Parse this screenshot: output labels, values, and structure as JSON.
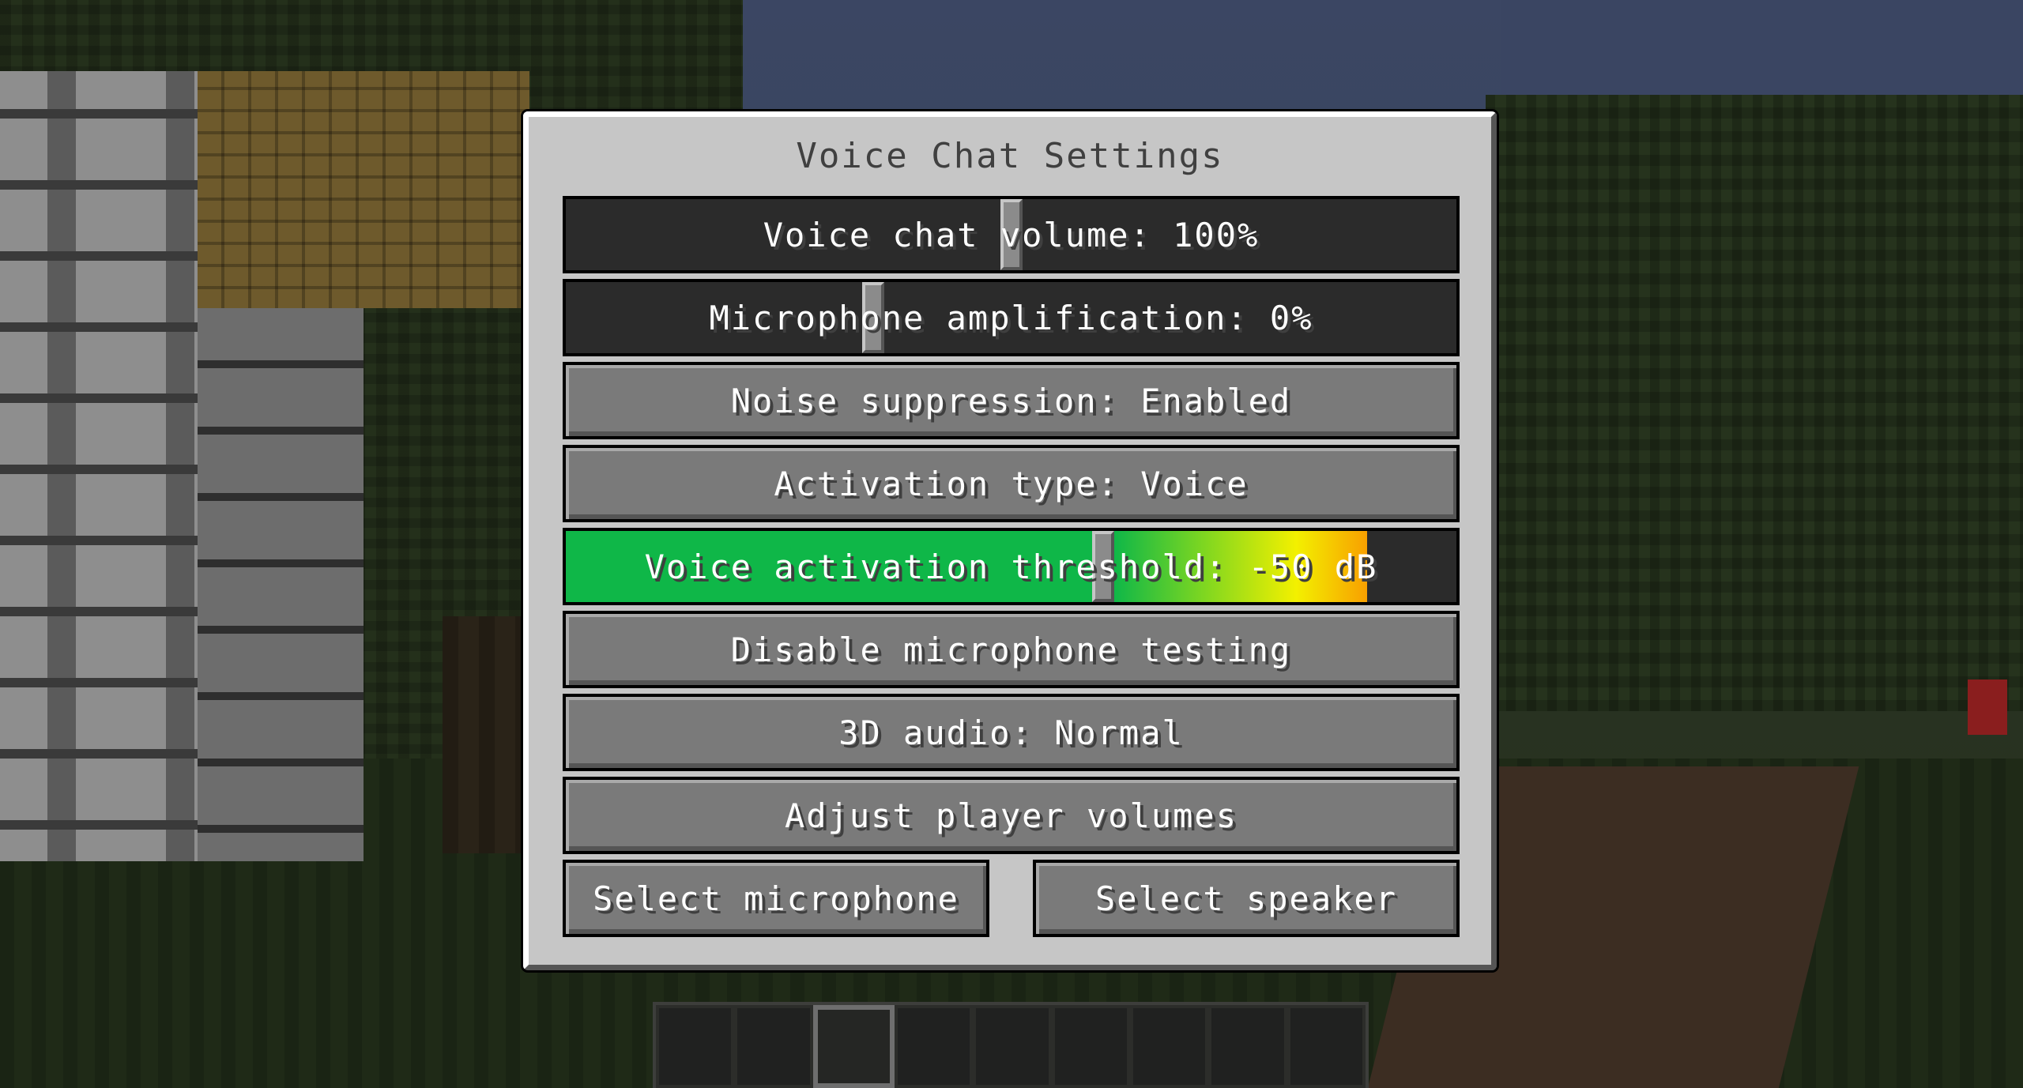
{
  "screen": {
    "title": "Voice Chat Settings",
    "sliders": {
      "voice_chat_volume": {
        "label": "Voice chat volume: 100%",
        "value_percent": 100
      },
      "microphone_amplification": {
        "label": "Microphone amplification: 0%",
        "value_percent": 0
      },
      "voice_activation_threshold": {
        "label": "Voice activation threshold: -50 dB",
        "value_db": -50,
        "meter_level_fraction": 0.9
      }
    },
    "buttons": {
      "noise_suppression": "Noise suppression: Enabled",
      "activation_type": "Activation type: Voice",
      "microphone_testing": "Disable microphone testing",
      "audio_3d": "3D audio: Normal",
      "player_volumes": "Adjust player volumes",
      "select_microphone": "Select microphone",
      "select_speaker": "Select speaker"
    }
  },
  "hotbar": {
    "slot_count": 9,
    "selected_slot": 3
  },
  "colors": {
    "panel_bg": "#c6c6c6",
    "button_bg": "#7a7a7a",
    "slider_bg": "#2b2b2b",
    "threshold_green": "#0fb748",
    "meter_yellow": "#f3f000",
    "meter_orange": "#f8a000"
  }
}
